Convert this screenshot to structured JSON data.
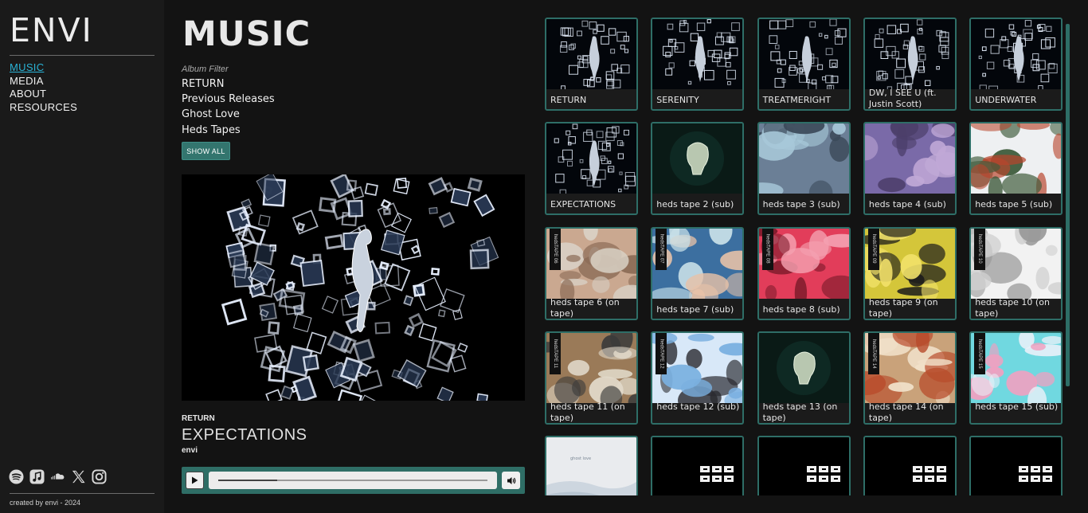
{
  "brand": "ENVI",
  "nav": [
    "MUSIC",
    "MEDIA",
    "ABOUT",
    "RESOURCES"
  ],
  "social_icons": [
    "spotify-icon",
    "apple-music-icon",
    "soundcloud-icon",
    "x-icon",
    "instagram-icon"
  ],
  "credit": "created by envi - 2024",
  "page_title": "MUSIC",
  "filter": {
    "label": "Album Filter",
    "items": [
      "RETURN",
      "Previous Releases",
      "Ghost Love",
      "Heds Tapes"
    ],
    "show_all": "SHOW ALL"
  },
  "now_playing": {
    "album": "RETURN",
    "title": "EXPECTATIONS",
    "artist": "envi",
    "progress": 0.22
  },
  "colors": {
    "accent": "#2e6e67",
    "nav_active": "#2ab3d6",
    "background": "#131313"
  },
  "tracks": [
    {
      "label": "RETURN"
    },
    {
      "label": "SERENITY"
    },
    {
      "label": "TREATMERIGHT"
    },
    {
      "label": "DW, I SEE U (ft. Justin Scott)"
    },
    {
      "label": "UNDERWATER"
    },
    {
      "label": "EXPECTATIONS"
    },
    {
      "label": "heds tape 2 (sub)"
    },
    {
      "label": "heds tape 3 (sub)"
    },
    {
      "label": "heds tape 4 (sub)"
    },
    {
      "label": "heds tape 5 (sub)"
    },
    {
      "label": "heds tape 6 (on tape)"
    },
    {
      "label": "heds tape 7 (sub)"
    },
    {
      "label": "heds tape 8 (sub)"
    },
    {
      "label": "heds tape 9 (on tape)"
    },
    {
      "label": "heds tape 10 (on tape)"
    },
    {
      "label": "heds tape 11 (on tape)"
    },
    {
      "label": "heds tape 12 (sub)"
    },
    {
      "label": "heds tape 13 (on tape)"
    },
    {
      "label": "heds tape 14 (on tape)"
    },
    {
      "label": "heds tape 15 (sub)"
    },
    {
      "label": ""
    },
    {
      "label": ""
    },
    {
      "label": ""
    },
    {
      "label": ""
    },
    {
      "label": ""
    }
  ],
  "tape_tags": [
    "hedsTAPE 06",
    "hedsTAPE 07",
    "hedsTAPE 08",
    "hedsTAPE 09",
    "hedsTAPE 10",
    "hedsTAPE 11",
    "hedsTAPE 12",
    "hedsTAPE 14",
    "hedsTAPE 15"
  ]
}
